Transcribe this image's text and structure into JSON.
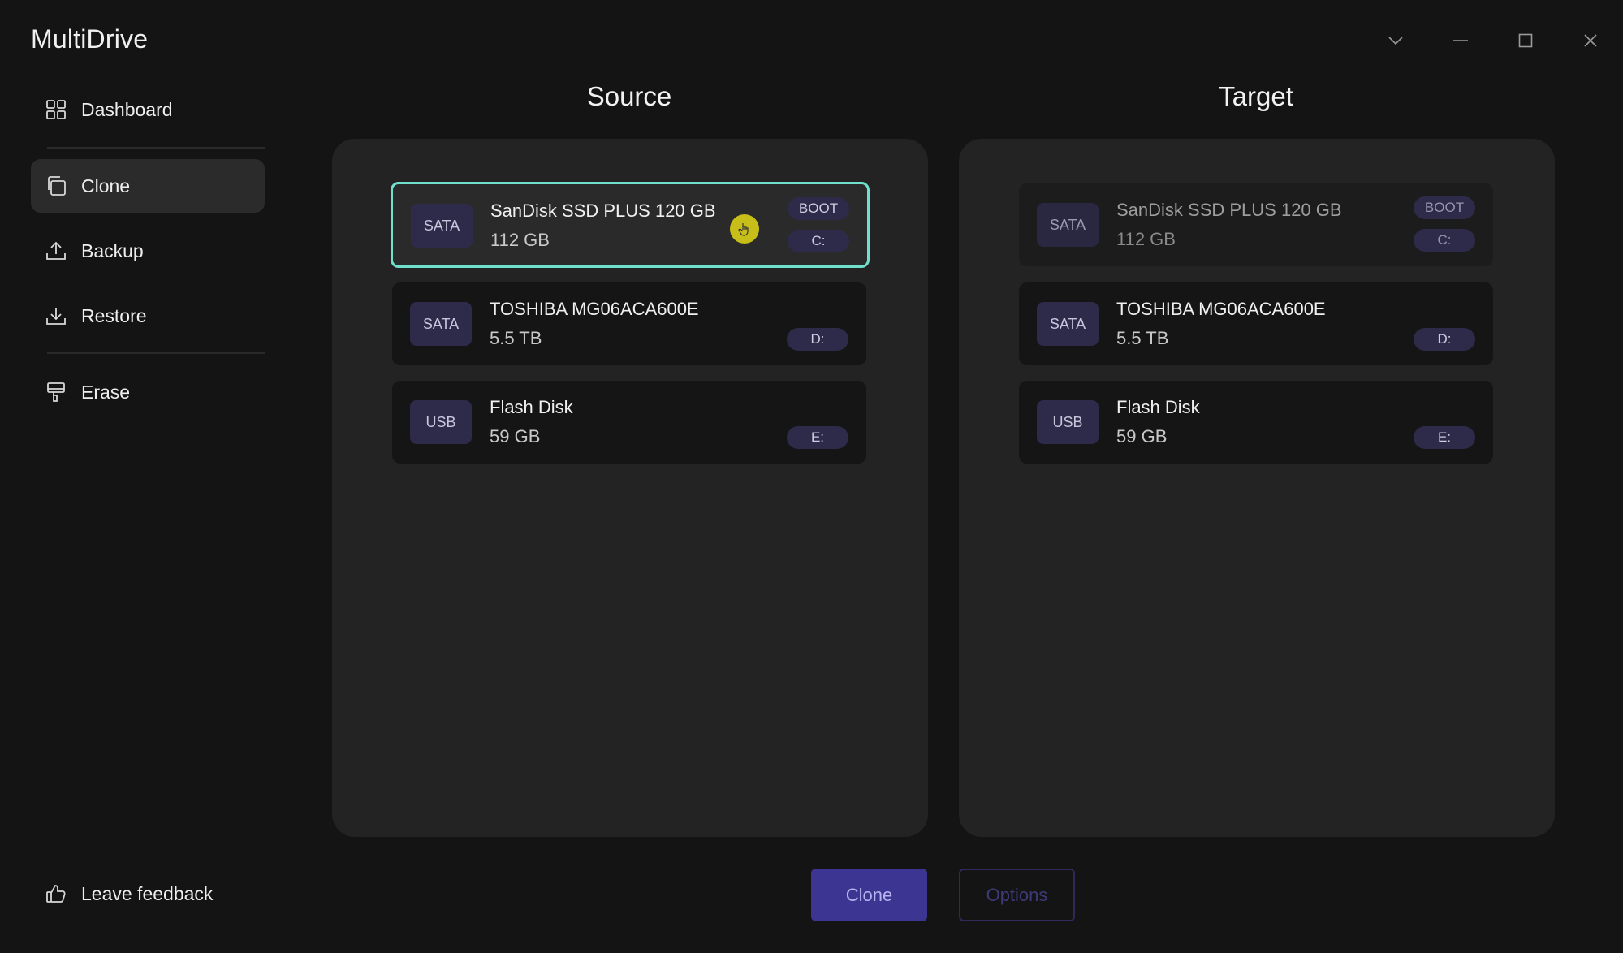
{
  "app": {
    "title": "MultiDrive"
  },
  "nav": {
    "items": [
      {
        "label": "Dashboard",
        "icon": "dashboard-grid-icon",
        "active": false
      },
      {
        "label": "Clone",
        "icon": "clone-icon",
        "active": true
      },
      {
        "label": "Backup",
        "icon": "upload-icon",
        "active": false
      },
      {
        "label": "Restore",
        "icon": "download-icon",
        "active": false
      },
      {
        "label": "Erase",
        "icon": "paint-brush-icon",
        "active": false
      }
    ],
    "feedback_label": "Leave feedback"
  },
  "source": {
    "title": "Source",
    "drives": [
      {
        "bus": "SATA",
        "name": "SanDisk SSD PLUS 120 GB",
        "size": "112 GB",
        "boot": "BOOT",
        "letter": "C:",
        "selected": true
      },
      {
        "bus": "SATA",
        "name": "TOSHIBA MG06ACA600E",
        "size": "5.5 TB",
        "letter": "D:"
      },
      {
        "bus": "USB",
        "name": "Flash Disk",
        "size": "59 GB",
        "letter": "E:"
      }
    ]
  },
  "target": {
    "title": "Target",
    "drives": [
      {
        "bus": "SATA",
        "name": "SanDisk SSD PLUS 120 GB",
        "size": "112 GB",
        "boot": "BOOT",
        "letter": "C:",
        "disabled": true
      },
      {
        "bus": "SATA",
        "name": "TOSHIBA MG06ACA600E",
        "size": "5.5 TB",
        "letter": "D:"
      },
      {
        "bus": "USB",
        "name": "Flash Disk",
        "size": "59 GB",
        "letter": "E:"
      }
    ]
  },
  "actions": {
    "clone_label": "Clone",
    "options_label": "Options"
  },
  "colors": {
    "accent": "#3d3592",
    "selection": "#6fe0cc",
    "badge": "#2e2a4a"
  }
}
